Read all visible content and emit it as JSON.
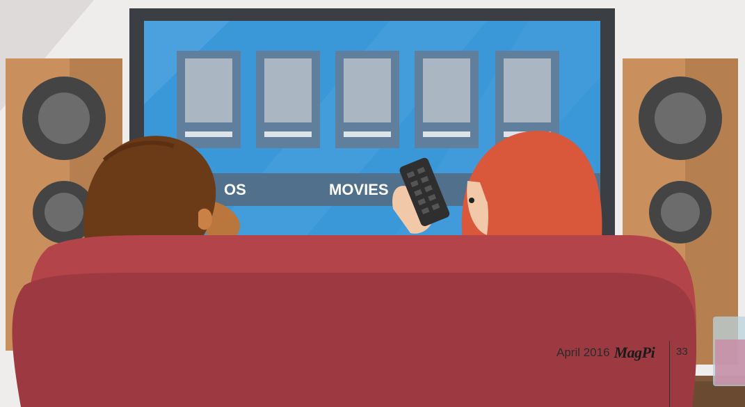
{
  "tv_menu": {
    "left_item": "OS",
    "right_item": "MOVIES"
  },
  "footer": {
    "date": "April 2016",
    "logo": "MagPi",
    "page_number": "33"
  }
}
